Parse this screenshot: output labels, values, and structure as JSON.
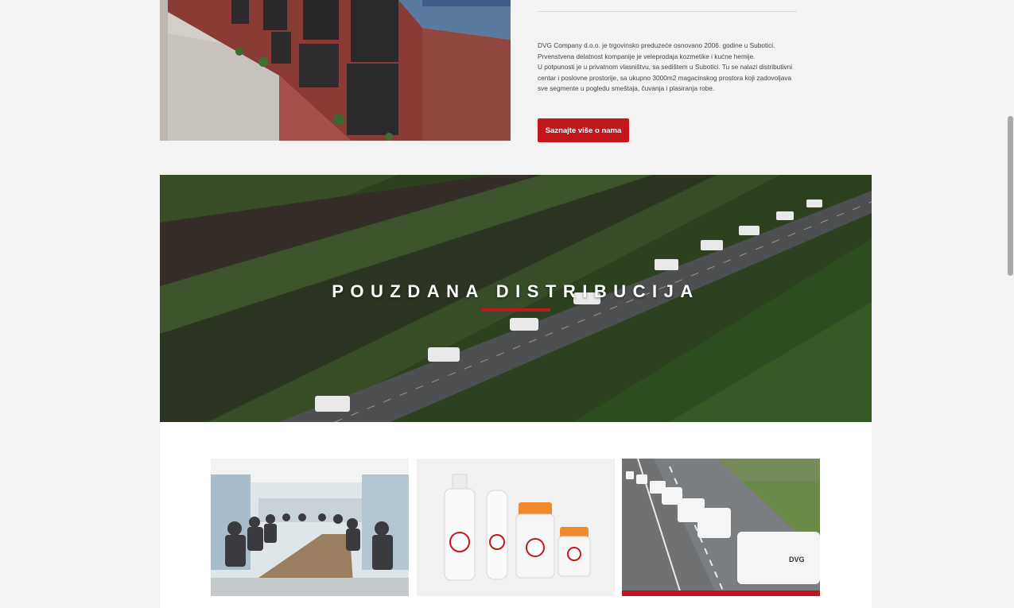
{
  "about": {
    "paragraph_1": "DVG Company d.o.o. je trgovinsko preduzeće osnovano 2006. godine u Subotici.",
    "paragraph_2": "Prvenstvena delatnost kompanije je veleprodaja kozmetike i kućne hemije.",
    "paragraph_3": "U potpunosti je u privatnom vlasništvu, sa sedištem u Subotici. Tu se nalazi distributivni centar i poslovne prostorije, sa ukupno 3000m2 magacinskog prostora koji zadovoljava sve segmente u pogledu smeštaja, čuvanja i plasiranja robe.",
    "cta_label": "Saznajte više o nama",
    "image_alt": "building-photo"
  },
  "banner": {
    "title": "POUZDANA DISTRIBUCIJA",
    "image": "aerial-road-vans-photo"
  },
  "cards": [
    {
      "image": "team-meeting-photo"
    },
    {
      "image": "mosquito-repellent-products-photo"
    },
    {
      "image": "dvg-vans-on-road-photo"
    }
  ],
  "colors": {
    "accent": "#c3161c",
    "background": "#f3f3f3",
    "section_white": "#ffffff"
  }
}
